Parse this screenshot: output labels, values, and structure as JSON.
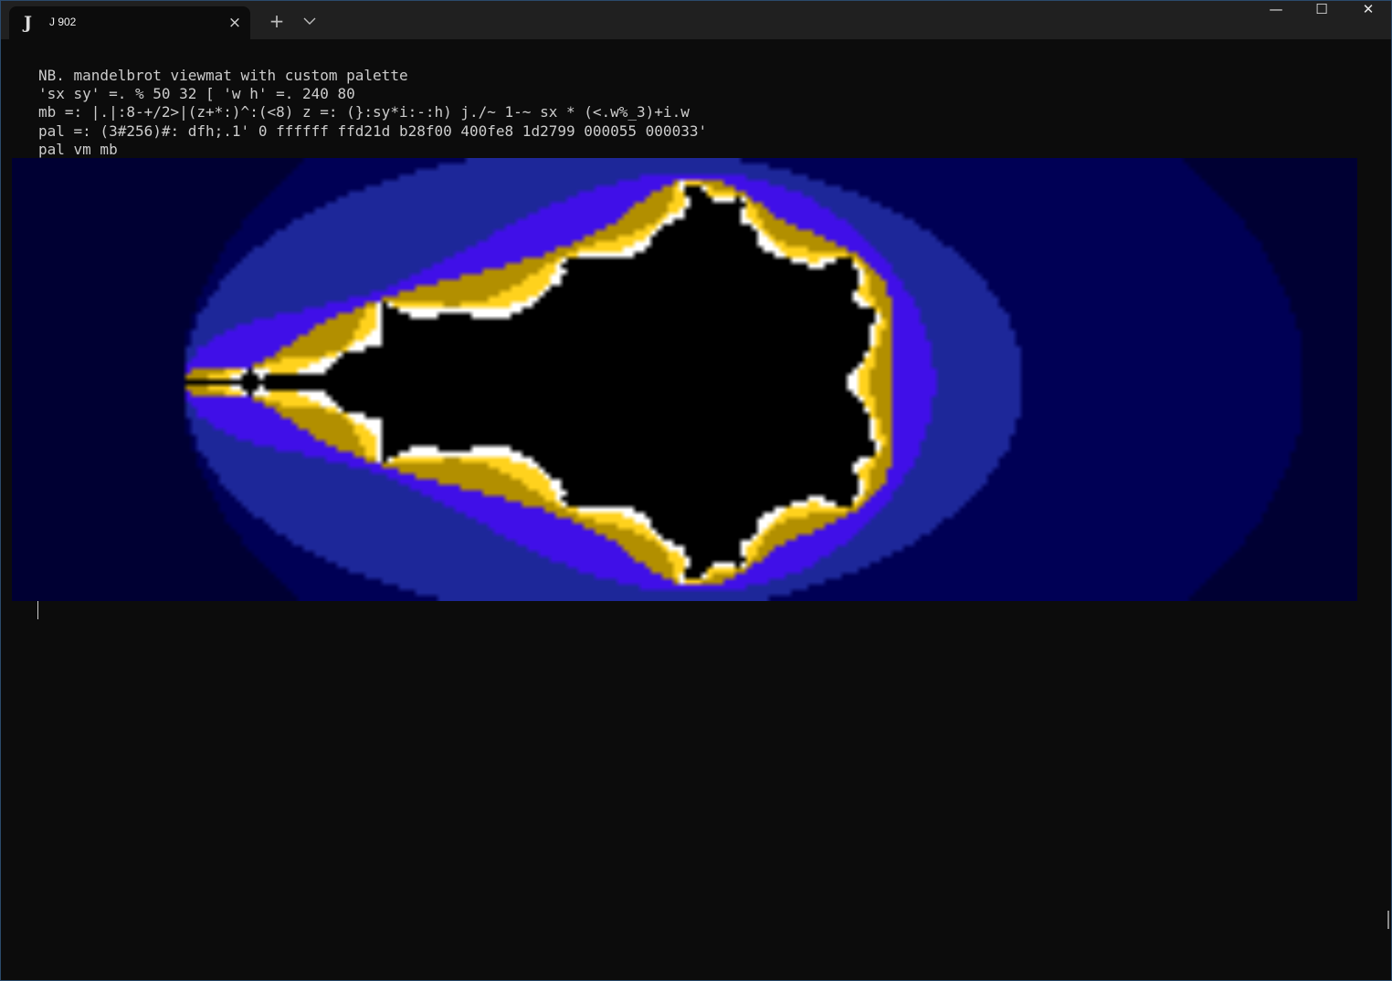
{
  "window": {
    "tab_icon": "J",
    "tab_title": "J 902",
    "tab_close_icon": "×",
    "new_tab_icon": "+",
    "tab_dropdown_icon": "chevron-down-icon",
    "minimize_icon": "—",
    "maximize_icon": "☐",
    "close_icon": "✕"
  },
  "console": {
    "lines": [
      "NB. mandelbrot viewmat with custom palette",
      "'sx sy' =. % 50 32 [ 'w h' =. 240 80",
      "mb =: |.|:8-+/2>|(z+*:)^:(<8) z =: (}:sy*i:-:h) j./~ 1-~ sx * (<.w%_3)+i.w",
      "pal =: (3#256)#: dfh;.1' 0 ffffff ffd21d b28f00 400fe8 1d2799 000055 000033'",
      "pal vm mb"
    ]
  },
  "viewmat": {
    "palette": [
      "#000000",
      "#ffffff",
      "#ffd21d",
      "#b28f00",
      "#400fe8",
      "#1d2799",
      "#000055",
      "#000033"
    ]
  }
}
